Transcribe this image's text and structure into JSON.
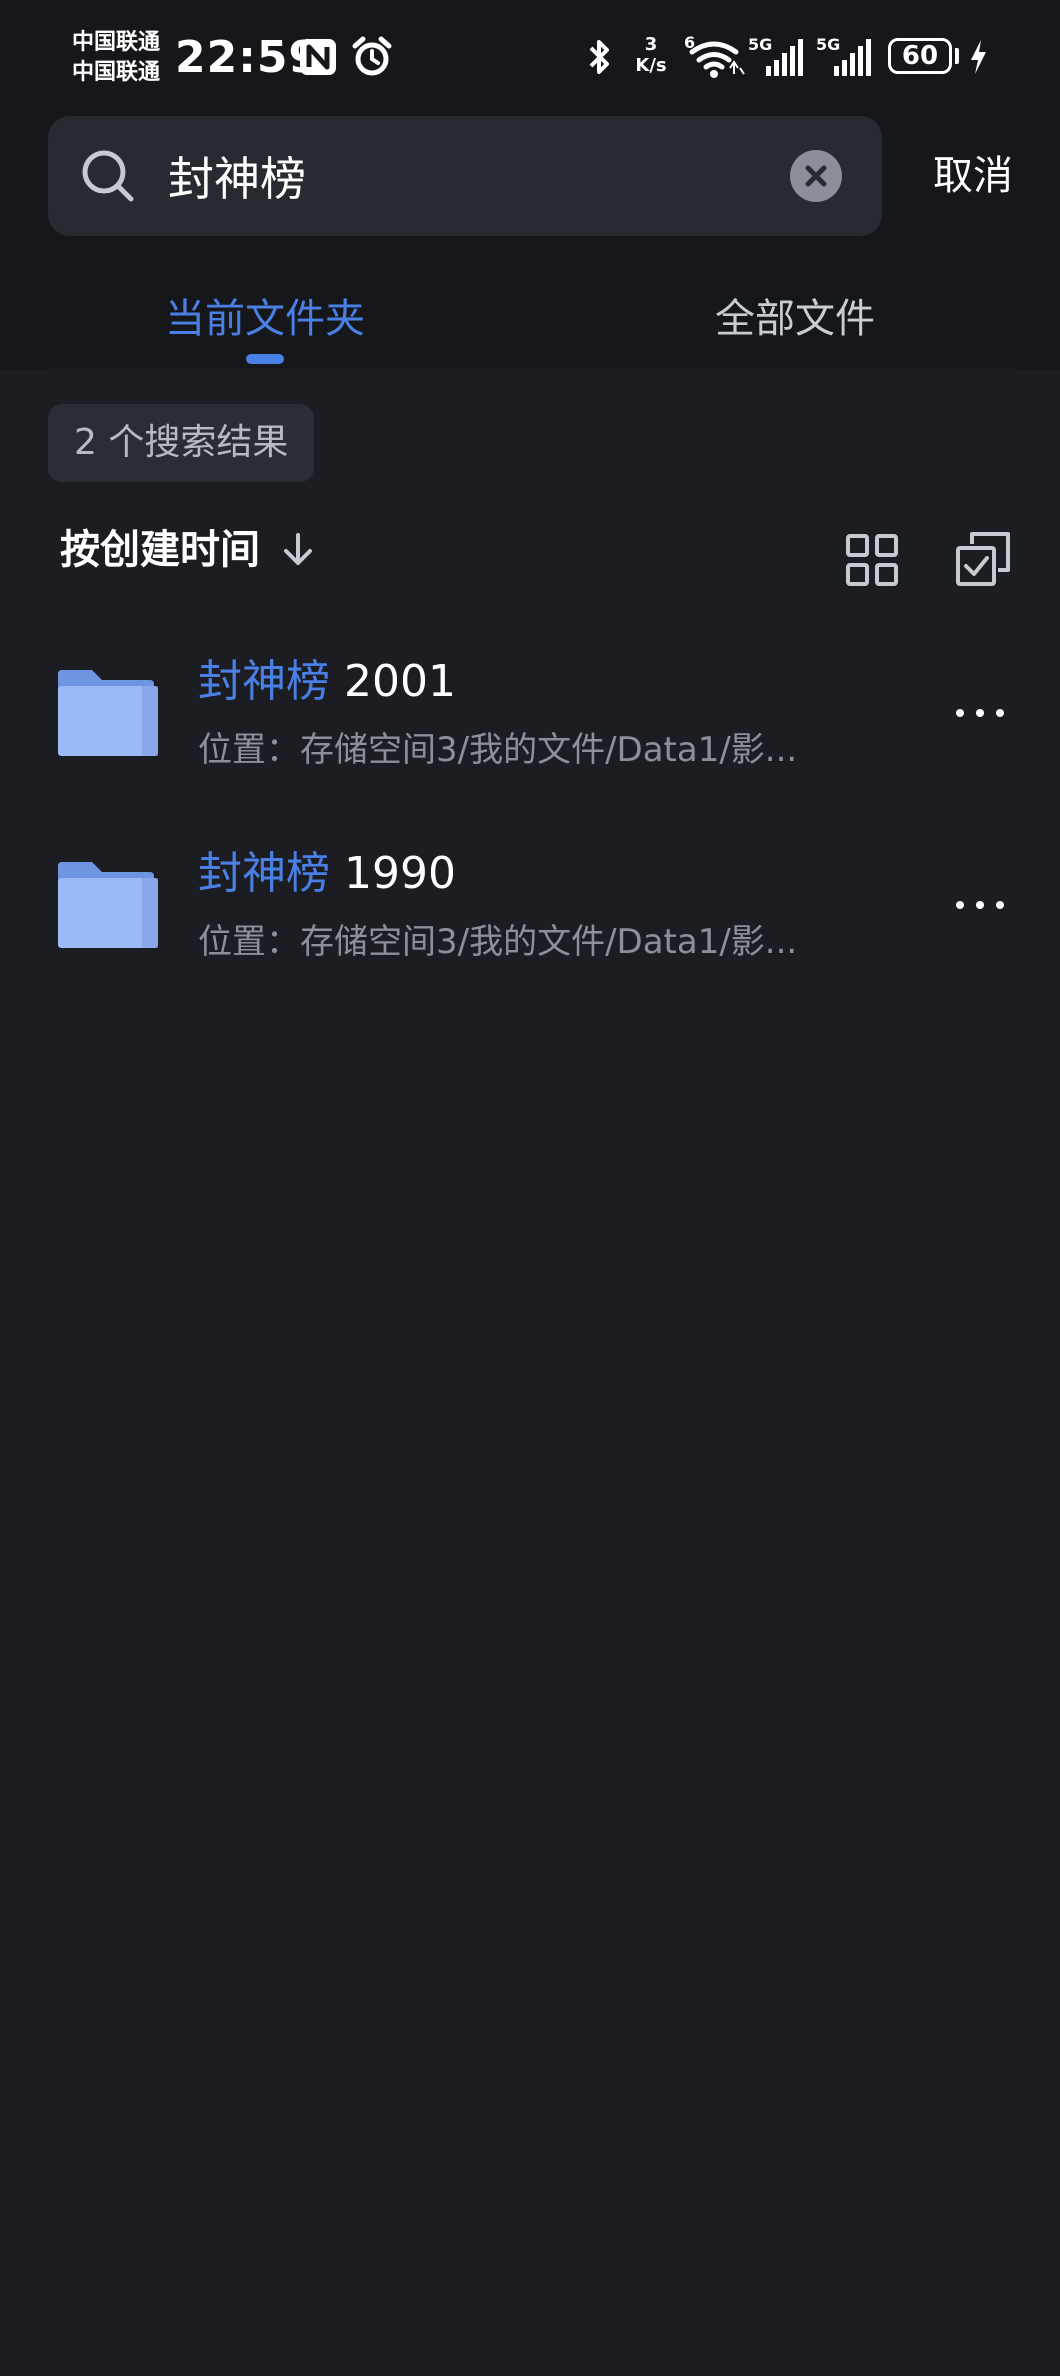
{
  "status_bar": {
    "carrier_1": "中国联通",
    "carrier_2": "中国联通",
    "time": "22:59",
    "net_speed_value": "3",
    "net_speed_unit": "K/s",
    "wifi_label": "6",
    "signal_1_label": "5G",
    "signal_2_label": "5G",
    "battery_level": "60",
    "icons": [
      "nfc-icon",
      "alarm-icon",
      "bluetooth-icon",
      "wifi-icon",
      "signal-icon",
      "battery-icon",
      "charging-icon"
    ]
  },
  "search": {
    "query": "封神榜",
    "placeholder": "",
    "cancel_label": "取消"
  },
  "tabs": [
    {
      "label": "当前文件夹",
      "active": true
    },
    {
      "label": "全部文件",
      "active": false
    }
  ],
  "results": {
    "count_label": "2 个搜索结果"
  },
  "sort": {
    "label": "按创建时间"
  },
  "items": [
    {
      "title_highlight": "封神榜",
      "title_rest": " 2001",
      "path": "位置：存储空间3/我的文件/Data1/影..."
    },
    {
      "title_highlight": "封神榜",
      "title_rest": " 1990",
      "path": "位置：存储空间3/我的文件/Data1/影..."
    }
  ],
  "colors": {
    "accent": "#4a80e6",
    "background": "#1b1d22",
    "folder": "#8fb0f2"
  }
}
